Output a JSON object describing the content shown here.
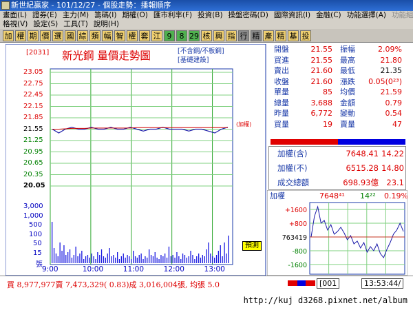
{
  "window": {
    "title": "新世紀贏家 - 101/12/27 - 個股走勢：播報順序"
  },
  "menu": {
    "row1": [
      "畫面(L)",
      "證券(E)",
      "主力(M)",
      "籌碼(I)",
      "期權(O)",
      "匯市利率(F)",
      "投資(B)",
      "操盤密碼(D)",
      "國際資訊(I)",
      "金融(C)",
      "功能選擇(A)",
      "功能組件(S)"
    ],
    "row2": [
      "格視(V)",
      "設定(S)",
      "工具(T)",
      "說明(H)"
    ]
  },
  "toolbar": {
    "buttons": [
      "加",
      "權",
      "期",
      "價",
      "選",
      "國",
      "綜",
      "類",
      "幅",
      "智",
      "權",
      "套",
      "江",
      "9",
      "8",
      "29",
      "核",
      "興",
      "指",
      "行",
      "精",
      "產",
      "精",
      "基",
      "投"
    ]
  },
  "stock": {
    "code": "[2031]",
    "title": "新光鋼  量價走勢圖",
    "note1": "[不含鋼/不板鋼]",
    "note2": "[基礎建設]"
  },
  "yaxis": {
    "price_ticks": [
      "23.05",
      "22.75",
      "22.45",
      "22.15",
      "21.85",
      "21.55",
      "21.25",
      "20.95",
      "20.65",
      "20.35",
      "20.05"
    ],
    "volume_ticks": [
      "3,000",
      "1,000",
      "500",
      "100",
      "50",
      "15",
      "張"
    ]
  },
  "xaxis": {
    "ticks": [
      "9:00",
      "10:00",
      "11:00",
      "12:00",
      "13:00"
    ]
  },
  "panel": {
    "rows": [
      {
        "l1": "開盤",
        "v1": "21.55",
        "l2": "振幅",
        "v2": "2.09%"
      },
      {
        "l1": "買進",
        "v1": "21.55",
        "l2": "最高",
        "v2": "21.80"
      },
      {
        "l1": "賣出",
        "v1": "21.60",
        "l2": "最低",
        "v2": "21.35"
      },
      {
        "l1": "收盤",
        "v1": "21.60",
        "l2": "漲跌",
        "v2": "0.05(0²³)"
      },
      {
        "l1": "單量",
        "v1": "85",
        "l2": "均價",
        "v2": "21.59"
      },
      {
        "l1": "總量",
        "v1": "3,688",
        "l2": "金額",
        "v2": "0.79"
      },
      {
        "l1": "昨量",
        "v1": "6,772",
        "l2": "變動",
        "v2": "0.54"
      },
      {
        "l1": "買量",
        "v1": "19",
        "l2": "賣量",
        "v2": "47"
      }
    ]
  },
  "index": {
    "rows": [
      {
        "label": "加權(含)",
        "value": "7648.41",
        "change": "14.22"
      },
      {
        "label": "加權(不)",
        "value": "6515.28",
        "change": "14.80"
      },
      {
        "label": "成交總額",
        "value": "698.93億",
        "change": "23.1"
      }
    ]
  },
  "mini": {
    "label": "加權",
    "value": "7648⁴¹",
    "change": "14²²",
    "pct": "0.19%",
    "ticks": [
      "+1600",
      "+800",
      "763419",
      "-800",
      "-1600"
    ]
  },
  "tags": {
    "weight": "(加權)",
    "pretrade": "預測"
  },
  "status": {
    "text": "買 8,977,977賣 7,473,329( 0.83)成 3,016,004張, 均張 5.0",
    "code": "[001",
    "time": "13:53:44/"
  },
  "watermark": {
    "url": "http://kuj d3268.pixnet.net/album"
  },
  "chart_data": {
    "type": "line",
    "series": [
      {
        "values": [
          21.55,
          21.45,
          21.55,
          21.6,
          21.55,
          21.55,
          21.6,
          21.55,
          21.55,
          21.6,
          21.55,
          21.55,
          21.6,
          21.55,
          21.5,
          21.55,
          21.55,
          21.6,
          21.55,
          21.55,
          21.55,
          21.5,
          21.55,
          21.55,
          21.5,
          21.45,
          21.55,
          21.6
        ]
      },
      {
        "values": [
          21.55,
          21.55,
          21.56,
          21.57,
          21.57,
          21.57,
          21.58,
          21.58,
          21.58,
          21.58,
          21.58,
          21.58,
          21.58,
          21.59,
          21.59,
          21.59,
          21.59,
          21.59,
          21.59,
          21.59,
          21.59,
          21.59,
          21.59,
          21.59,
          21.59,
          21.59,
          21.59,
          21.59
        ]
      }
    ],
    "ylim": [
      20.05,
      23.05
    ]
  }
}
